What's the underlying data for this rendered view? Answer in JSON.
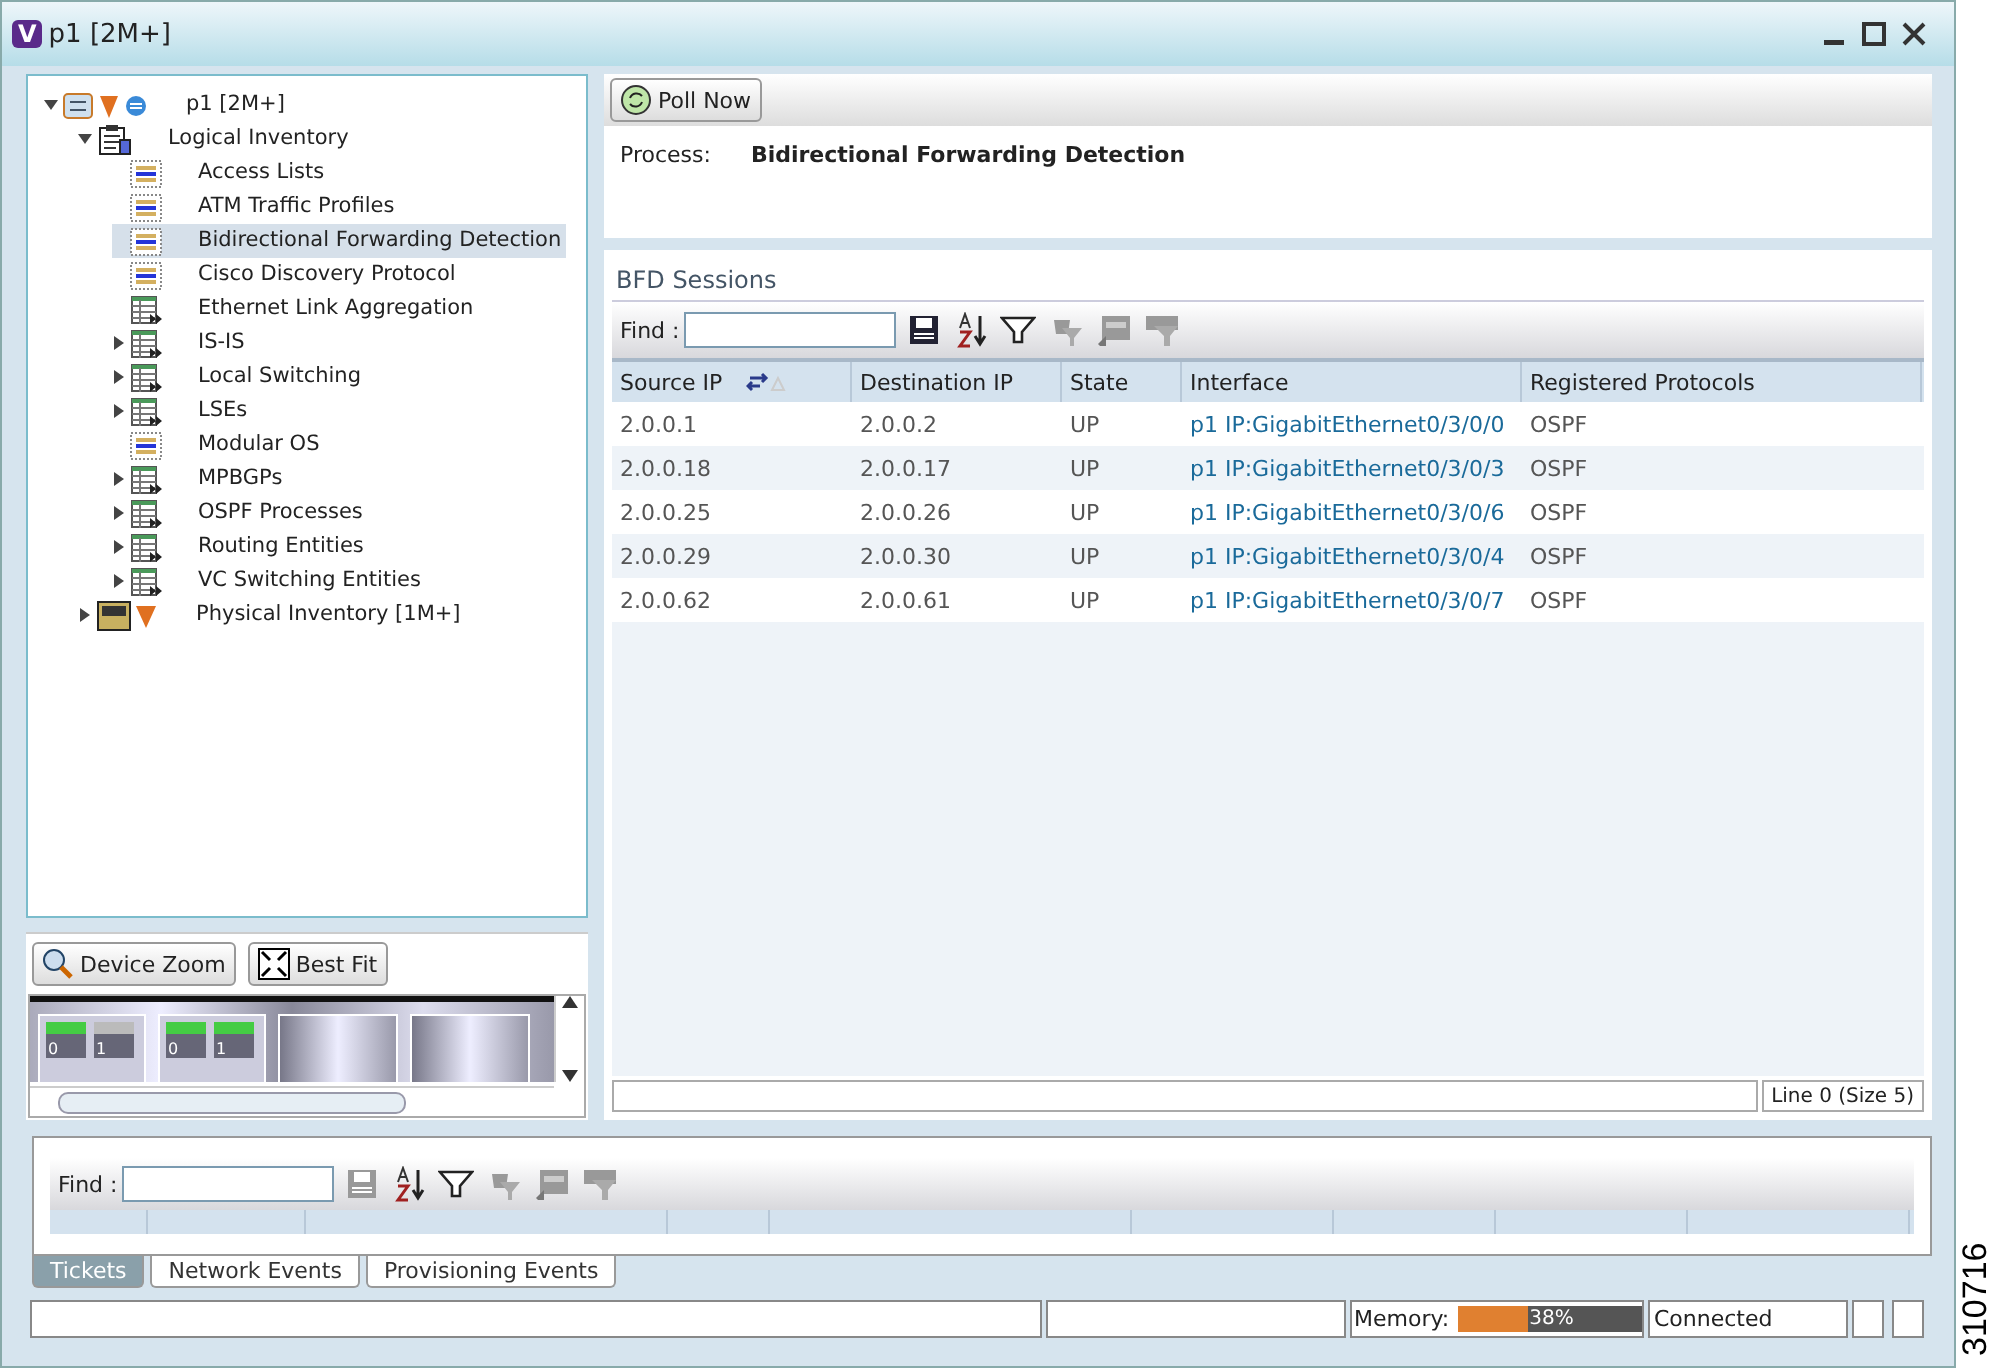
{
  "window": {
    "title": "p1 [2M+]",
    "logo": "V"
  },
  "tree": [
    {
      "label": "p1 [2M+]",
      "kind": "device",
      "expanded": true,
      "selected": false,
      "children": [
        {
          "label": "Logical Inventory",
          "kind": "clipboard",
          "expanded": true,
          "selected": false,
          "children": [
            {
              "label": "Access Lists",
              "kind": "table-blue",
              "selected": false
            },
            {
              "label": "ATM Traffic Profiles",
              "kind": "table-blue",
              "selected": false
            },
            {
              "label": "Bidirectional Forwarding Detection",
              "kind": "table-blue",
              "selected": true
            },
            {
              "label": "Cisco Discovery Protocol",
              "kind": "table-blue",
              "selected": false
            },
            {
              "label": "Ethernet Link Aggregation",
              "kind": "table-green",
              "selected": false
            },
            {
              "label": "IS-IS",
              "kind": "table-green",
              "expanded": false,
              "selected": false
            },
            {
              "label": "Local Switching",
              "kind": "table-green",
              "expanded": false,
              "selected": false
            },
            {
              "label": "LSEs",
              "kind": "table-green",
              "expanded": false,
              "selected": false
            },
            {
              "label": "Modular OS",
              "kind": "table-blue",
              "selected": false
            },
            {
              "label": "MPBGPs",
              "kind": "table-green",
              "expanded": false,
              "selected": false
            },
            {
              "label": "OSPF Processes",
              "kind": "table-green",
              "expanded": false,
              "selected": false
            },
            {
              "label": "Routing Entities",
              "kind": "table-green",
              "expanded": false,
              "selected": false
            },
            {
              "label": "VC Switching Entities",
              "kind": "table-green",
              "expanded": false,
              "selected": false
            }
          ]
        },
        {
          "label": "Physical Inventory [1M+]",
          "kind": "chassis",
          "expanded": false,
          "selected": false
        }
      ]
    }
  ],
  "device_view": {
    "buttons": [
      "Device Zoom",
      "Best Fit"
    ],
    "ports": [
      "0",
      "1",
      "0",
      "1"
    ]
  },
  "poll_button": "Poll Now",
  "process": {
    "label": "Process:",
    "value": "Bidirectional Forwarding Detection"
  },
  "sessions": {
    "title": "BFD Sessions",
    "find_label": "Find :",
    "columns": [
      "Source IP",
      "Destination IP",
      "State",
      "Interface",
      "Registered Protocols"
    ],
    "rows": [
      [
        "2.0.0.1",
        "2.0.0.2",
        "UP",
        "p1 IP:GigabitEthernet0/3/0/0",
        "OSPF"
      ],
      [
        "2.0.0.18",
        "2.0.0.17",
        "UP",
        "p1 IP:GigabitEthernet0/3/0/3",
        "OSPF"
      ],
      [
        "2.0.0.25",
        "2.0.0.26",
        "UP",
        "p1 IP:GigabitEthernet0/3/0/6",
        "OSPF"
      ],
      [
        "2.0.0.29",
        "2.0.0.30",
        "UP",
        "p1 IP:GigabitEthernet0/3/0/4",
        "OSPF"
      ],
      [
        "2.0.0.62",
        "2.0.0.61",
        "UP",
        "p1 IP:GigabitEthernet0/3/0/7",
        "OSPF"
      ]
    ],
    "footer": "Line 0 (Size 5)"
  },
  "bottom": {
    "find_label": "Find :",
    "tabs": [
      {
        "label": "Tickets",
        "selected": true
      },
      {
        "label": "Network Events",
        "selected": false
      },
      {
        "label": "Provisioning Events",
        "selected": false
      }
    ]
  },
  "status_bar": {
    "memory_label": "Memory:",
    "memory": {
      "level": 0.38,
      "reading": "38%"
    },
    "connection": "Connected"
  },
  "figure_number": "310716"
}
